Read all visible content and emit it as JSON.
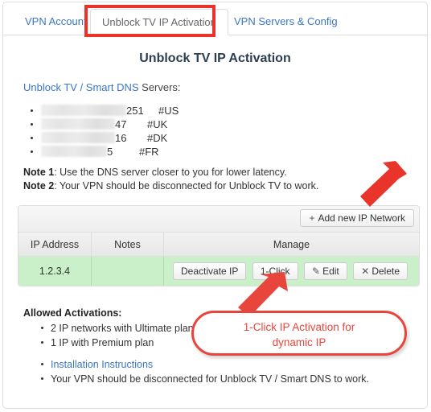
{
  "tabs": [
    {
      "label": "VPN Account",
      "active": false
    },
    {
      "label": "Unblock TV IP Activation",
      "active": true
    },
    {
      "label": "VPN Servers & Config",
      "active": false
    }
  ],
  "heading": "Unblock TV IP Activation",
  "servers_section": {
    "label_link": "Unblock TV / Smart DNS",
    "label_tail": " Servers:",
    "items": [
      {
        "masked_width": 106,
        "octet": "251",
        "country": "#US"
      },
      {
        "masked_width": 92,
        "octet": "47",
        "country": "#UK"
      },
      {
        "masked_width": 92,
        "octet": "16",
        "country": "#DK"
      },
      {
        "masked_width": 82,
        "octet": "5",
        "country": "#FR"
      }
    ]
  },
  "notes": [
    {
      "label": "Note 1",
      "text": ": Use the DNS server closer to you for lower latency."
    },
    {
      "label": "Note 2",
      "text": ": Your VPN should be disconnected for Unblock TV to work."
    }
  ],
  "panel": {
    "add_button": {
      "icon": "plus-icon",
      "label": "Add new IP Network"
    },
    "columns": [
      "IP Address",
      "Notes",
      "Manage"
    ],
    "rows": [
      {
        "ip_address": "1.2.3.4",
        "notes": "",
        "actions": [
          {
            "label": "Deactivate IP",
            "icon": ""
          },
          {
            "label": "1-Click",
            "icon": ""
          },
          {
            "label": "Edit",
            "icon": "pencil-icon"
          },
          {
            "label": "Delete",
            "icon": "x-icon"
          }
        ]
      }
    ]
  },
  "allowed": {
    "title": "Allowed Activations:",
    "items": [
      {
        "text": "2 IP networks with Ultimate plan",
        "link": false
      },
      {
        "text": "1 IP with Premium plan",
        "link": false
      },
      {
        "text": "Installation Instructions",
        "link": true
      },
      {
        "text": "Your VPN should be disconnected for Unblock TV / Smart DNS to work.",
        "link": false
      }
    ]
  },
  "annotations": {
    "callout_line1": "1-Click IP Activation for",
    "callout_line2": "dynamic IP",
    "highlight_color": "#e8342a",
    "callout_color": "#e8463c"
  }
}
